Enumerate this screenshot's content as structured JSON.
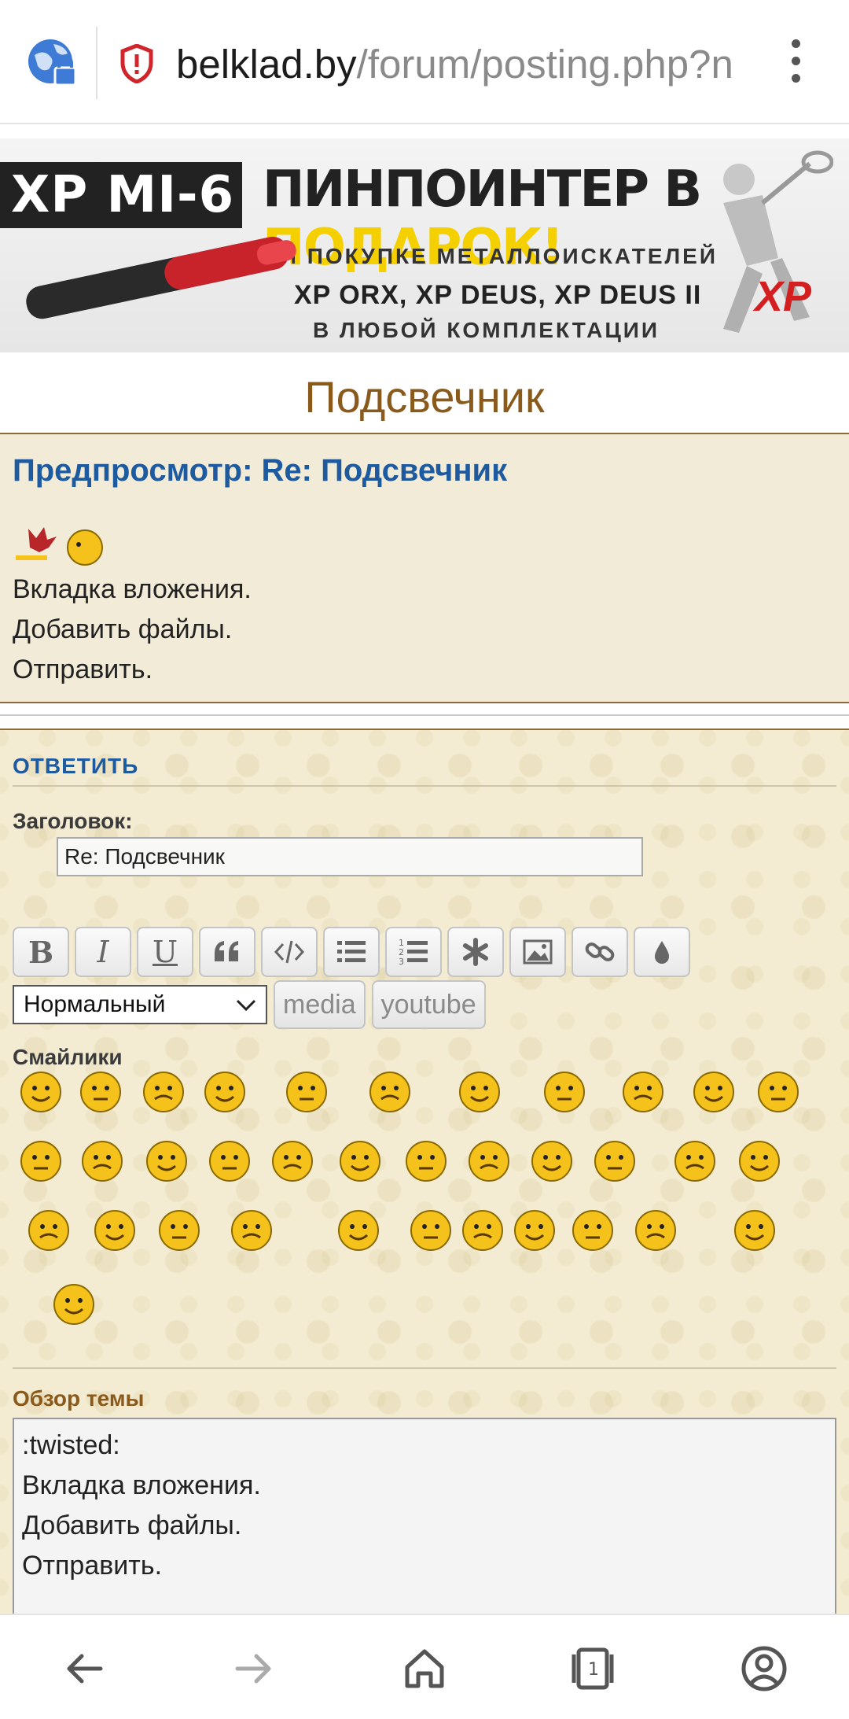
{
  "browser": {
    "url_host": "belklad.by",
    "url_path": "/forum/posting.php?n"
  },
  "banner": {
    "model": "XP MI-6",
    "headline_a": "ПИНПОИНТЕР В ",
    "headline_b": "ПОДАРОК!",
    "line1": "ПРИ ПОКУПКЕ МЕТАЛЛОИСКАТЕЛЕЙ",
    "line2": "XP ORX, XP DEUS, XP DEUS II",
    "line3": "В ЛЮБОЙ КОМПЛЕКТАЦИИ",
    "logo": "XP",
    "colors": {
      "highlight": "#f5d000",
      "logo": "#d31f1f"
    }
  },
  "topic": {
    "title": "Подсвечник"
  },
  "preview": {
    "title": "Предпросмотр: Re: Подсвечник",
    "lines": [
      "Вкладка вложения.",
      "Добавить файлы.",
      "Отправить."
    ]
  },
  "reply": {
    "heading": "ОТВЕТИТЬ",
    "subject_label": "Заголовок:",
    "subject_value": "Re: Подсвечник",
    "toolbar": {
      "bold": "B",
      "italic": "I",
      "underline": "U",
      "icons": [
        "quote-icon",
        "code-icon",
        "list-icon",
        "numbered-list-icon",
        "asterisk-icon",
        "image-icon",
        "link-icon",
        "color-drop-icon"
      ]
    },
    "format_select": "Нормальный",
    "media_button": "media",
    "youtube_button": "youtube",
    "smilies_label": "Смайлики",
    "review_label": "Обзор темы",
    "message_lines": [
      ":twisted:",
      "Вкладка вложения.",
      "Добавить файлы.",
      "Отправить."
    ]
  },
  "colors": {
    "link_blue": "#1d5aa0",
    "brown": "#8a5a1c",
    "panel_bg": "#f2ebd7",
    "smiley_yellow": "#f4c21a"
  }
}
